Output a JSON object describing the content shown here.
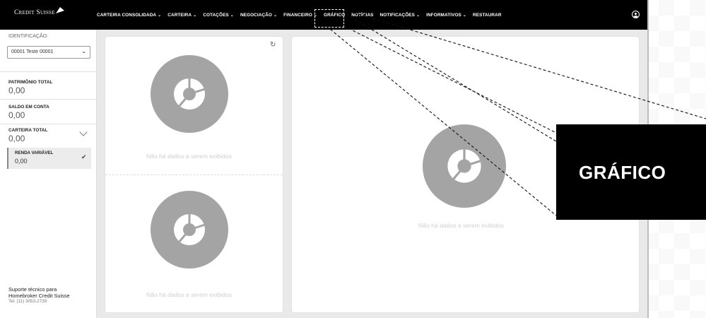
{
  "brand": {
    "logo_text": "Credit Suisse"
  },
  "nav": {
    "items": [
      {
        "label": "CARTEIRA CONSOLIDADA",
        "dropdown": true
      },
      {
        "label": "CARTEIRA",
        "dropdown": true
      },
      {
        "label": "COTAÇÕES",
        "dropdown": true
      },
      {
        "label": "NEGOCIAÇÃO",
        "dropdown": true
      },
      {
        "label": "FINANCEIRO",
        "dropdown": true
      },
      {
        "label": "GRÁFICO",
        "dropdown": false
      },
      {
        "label": "NOTÍCIAS",
        "dropdown": false
      },
      {
        "label": "NOTIFICAÇÕES",
        "dropdown": true
      },
      {
        "label": "INFORMATIVOS",
        "dropdown": true
      },
      {
        "label": "RESTAURAR",
        "dropdown": false
      }
    ],
    "user_icon": "user-circle-icon"
  },
  "sidebar": {
    "identificacao_label": "IDENTIFICAÇÃO:",
    "identificacao_value": "00001 Teste 00001",
    "patrimonio_label": "PATRIMÔNIO TOTAL",
    "patrimonio_value": "0,00",
    "saldo_label": "SALDO EM CONTA",
    "saldo_value": "0,00",
    "carteira_label": "CARTEIRA TOTAL",
    "carteira_value": "0,00",
    "renda_label": "RENDA VARIÁVEL",
    "renda_value": "0,00",
    "support_line1": "Suporte técnico para",
    "support_line2": "Homebroker Credit Suisse",
    "support_tel": "Tel: (11) 3053-2739"
  },
  "panels": {
    "empty_message": "Não há dados a serem exibidos"
  },
  "callout": {
    "text": "GRÁFICO"
  },
  "colors": {
    "topbar": "#000000",
    "donut": "#a4a4a4",
    "background": "#e9e9e9"
  }
}
